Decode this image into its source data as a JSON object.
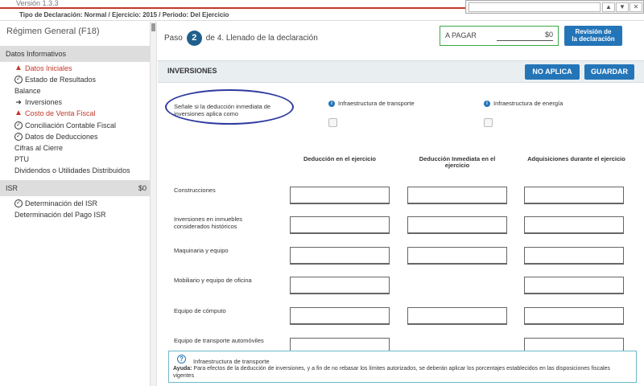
{
  "topbar": {
    "version": "Versión 1.3.3",
    "declaration": "Tipo de Declaración: Normal / Ejercicio: 2015 / Periodo: Del Ejercicio"
  },
  "sidebar": {
    "title": "Régimen General (F18)",
    "sections": [
      {
        "label": "Datos Informativos",
        "amount": ""
      },
      {
        "label": "ISR",
        "amount": "$0"
      }
    ],
    "items": [
      {
        "label": "Datos Iniciales",
        "icon": "warning-icon",
        "warn": true
      },
      {
        "label": "Estado de Resultados",
        "icon": "check-circle-icon",
        "warn": false
      },
      {
        "label": "Balance",
        "icon": "",
        "warn": false
      },
      {
        "label": "Inversiones",
        "icon": "arrow-right-icon",
        "warn": false
      },
      {
        "label": "Costo de Venta Fiscal",
        "icon": "warning-icon",
        "warn": true
      },
      {
        "label": "Conciliación Contable Fiscal",
        "icon": "check-circle-icon",
        "warn": false
      },
      {
        "label": "Datos de Deducciones",
        "icon": "check-circle-icon",
        "warn": false
      },
      {
        "label": "Cifras al Cierre",
        "icon": "",
        "warn": false
      },
      {
        "label": "PTU",
        "icon": "",
        "warn": false
      },
      {
        "label": "Dividendos o Utilidades Distribuidos",
        "icon": "",
        "warn": false
      }
    ],
    "isr_items": [
      {
        "label": "Determinación del ISR",
        "icon": "check-circle-icon"
      },
      {
        "label": "Determinación del Pago ISR",
        "icon": ""
      }
    ]
  },
  "step": {
    "prefix": "Paso",
    "number": "2",
    "suffix": "de 4. Llenado de la declaración"
  },
  "pagar": {
    "label": "A PAGAR",
    "value": "$0"
  },
  "review_button": {
    "line1": "Revisión de",
    "line2": "la declaración"
  },
  "section": {
    "title": "INVERSIONES",
    "no_aplica": "NO APLICA",
    "guardar": "GUARDAR"
  },
  "question": {
    "text": "Señale si la deducción inmediata de inversiones aplica como",
    "options": [
      "Infraestructura de transporte",
      "Infraestructura de energía"
    ]
  },
  "table": {
    "columns": [
      "Deducción en el ejercicio",
      "Deducción Inmediata en el ejercicio",
      "Adquisiciones durante el ejercicio"
    ],
    "rows": [
      {
        "label": "Construcciones"
      },
      {
        "label": "Inversiones en inmuebles considerados históricos"
      },
      {
        "label": "Maquinaria y equipo"
      },
      {
        "label": "Mobiliario y equipo de oficina"
      },
      {
        "label": "Equipo de cómputo"
      },
      {
        "label": "Equipo de transporte automóviles"
      }
    ]
  },
  "help": {
    "title": "Infraestructura de transporte",
    "prefix": "Ayuda:",
    "body": "Para efectos de la deducción de inversiones, y a fin de no rebasar los límites autorizados, se deberán aplicar los porcentajes establecidos en las disposiciones fiscales vigentes"
  },
  "colors": {
    "accent": "#2475b8",
    "warning": "#c0392b",
    "highlight_oval": "#2e3a9e"
  }
}
